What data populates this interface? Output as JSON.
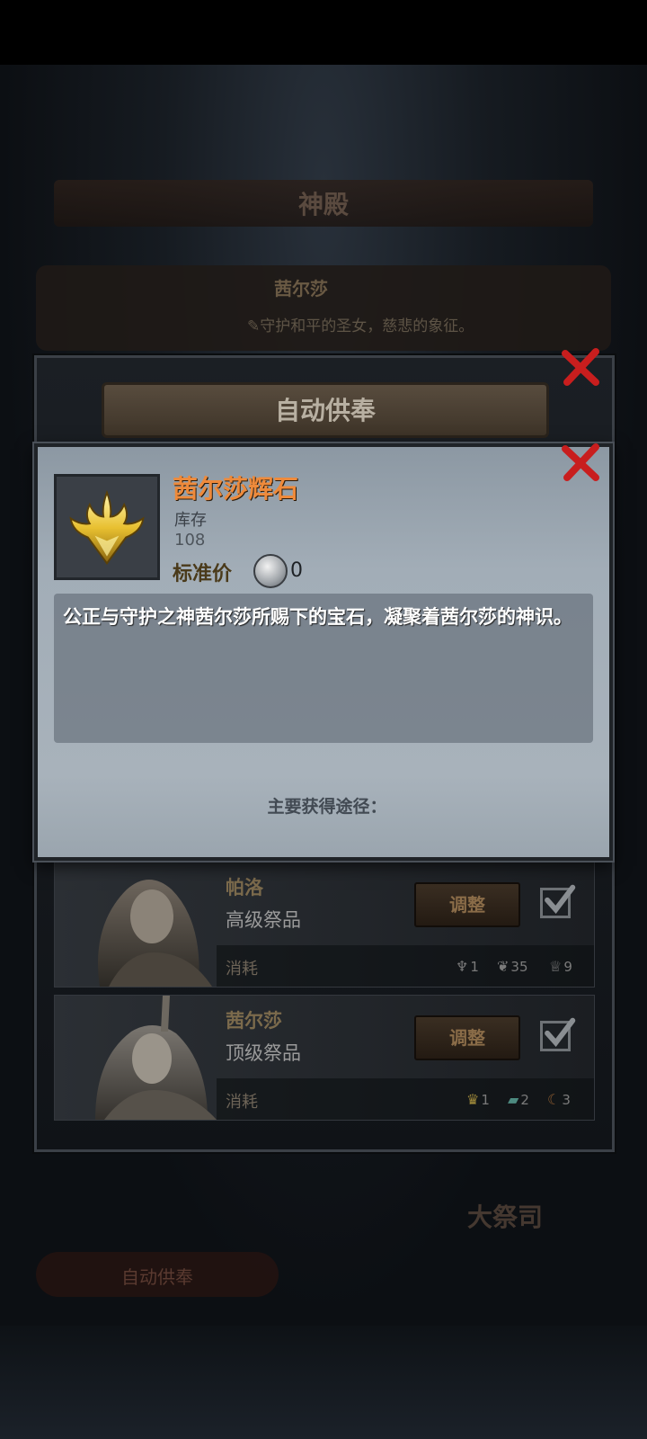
{
  "background": {
    "temple_title": "神殿",
    "deity_name": "茜尔莎",
    "deity_motto": "守护和平的圣女，慈悲的象征。",
    "auto_offer_button": "自动供奉",
    "high_priest_label": "大祭司"
  },
  "auto_offer_panel": {
    "title": "自动供奉",
    "offerings": [
      {
        "name": "帕洛",
        "grade": "高级祭品",
        "adjust_label": "调整",
        "checked": true,
        "consume_label": "消耗",
        "costs": [
          {
            "icon": "horn-icon",
            "amount": "1"
          },
          {
            "icon": "feather-icon",
            "amount": "35"
          },
          {
            "icon": "goblet-icon",
            "amount": "9"
          }
        ]
      },
      {
        "name": "茜尔莎",
        "grade": "顶级祭品",
        "adjust_label": "调整",
        "checked": true,
        "consume_label": "消耗",
        "costs": [
          {
            "icon": "crown-crystal-icon",
            "amount": "1"
          },
          {
            "icon": "scroll-icon",
            "amount": "2"
          },
          {
            "icon": "horn-icon",
            "amount": "3"
          }
        ]
      }
    ]
  },
  "item_dialog": {
    "name": "茜尔莎辉石",
    "stock_label": "库存",
    "stock_value": "108",
    "price_label": "标准价",
    "price_value": "0",
    "description": "公正与守护之神茜尔莎所赐下的宝石，凝聚着茜尔莎的神识。",
    "source_label": "主要获得途径："
  },
  "colors": {
    "item_name": "#ee8a3b",
    "close_x": "#c81e1e",
    "dialog_bg": "#a2adb7"
  }
}
